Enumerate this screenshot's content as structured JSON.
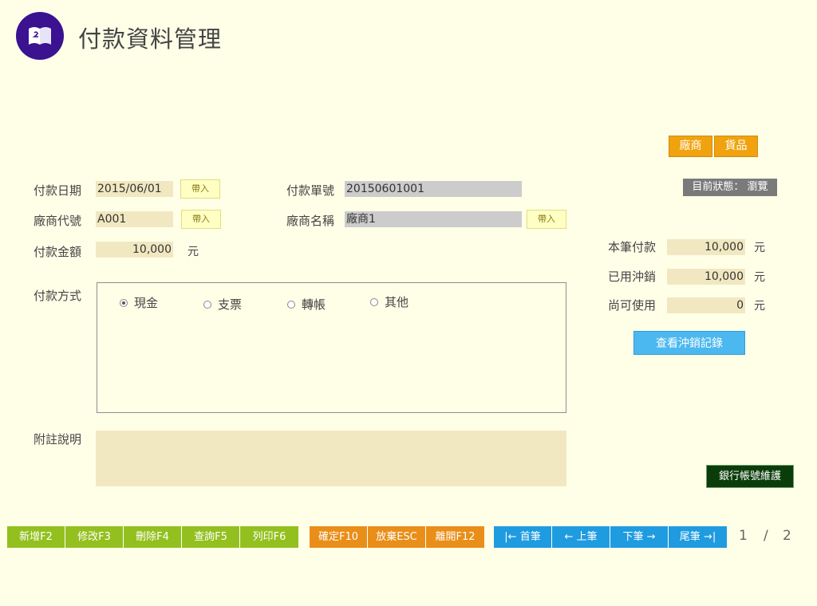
{
  "header": {
    "title": "付款資料管理",
    "logo_icon": "book-icon"
  },
  "top_buttons": {
    "vendor": "廠商",
    "goods": "貨品"
  },
  "status": {
    "label": "目前狀態： 瀏覽"
  },
  "form": {
    "pay_date": {
      "label": "付款日期",
      "value": "2015/06/01",
      "import": "帶入"
    },
    "pay_no": {
      "label": "付款單號",
      "value": "20150601001"
    },
    "vendor_code": {
      "label": "廠商代號",
      "value": "A001",
      "import": "帶入"
    },
    "vendor_name": {
      "label": "廠商名稱",
      "value": "廠商1",
      "import": "帶入"
    },
    "amount": {
      "label": "付款金額",
      "value": "10,000",
      "unit": "元"
    },
    "method": {
      "label": "付款方式",
      "options": [
        "現金",
        "支票",
        "轉帳",
        "其他"
      ],
      "selected": "現金"
    },
    "note": {
      "label": "附註說明",
      "value": ""
    }
  },
  "summary": {
    "this_pay": {
      "label": "本筆付款",
      "value": "10,000",
      "unit": "元"
    },
    "used": {
      "label": "已用沖銷",
      "value": "10,000",
      "unit": "元"
    },
    "remaining": {
      "label": "尚可使用",
      "value": "0",
      "unit": "元"
    },
    "view_button": "查看沖銷記錄"
  },
  "bank_button": "銀行帳號維護",
  "toolbar": {
    "add": "新增F2",
    "edit": "修改F3",
    "delete": "刪除F4",
    "query": "查詢F5",
    "print": "列印F6",
    "confirm": "確定F10",
    "abandon": "放棄ESC",
    "leave": "離開F12",
    "first": "|← 首筆",
    "prev": "← 上筆",
    "next": "下筆 →",
    "last": "尾筆 →|"
  },
  "pagination": {
    "current": "1",
    "separator": "/",
    "total": "2"
  },
  "colors": {
    "header_logo": "#3B1290",
    "field_bg": "#F1E8C1",
    "page_bg": "#FFFFE8"
  }
}
